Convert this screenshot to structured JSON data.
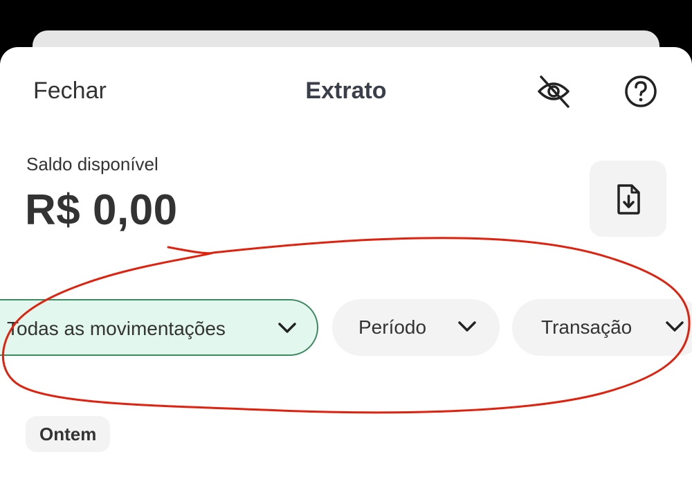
{
  "header": {
    "close_label": "Fechar",
    "title": "Extrato",
    "visibility_icon": "eye-off-icon",
    "help_icon": "help-circle-icon"
  },
  "balance": {
    "label": "Saldo disponível",
    "value": "R$ 0,00",
    "download_icon": "file-download-icon"
  },
  "filters": [
    {
      "label": "Todas as movimentações",
      "selected": true
    },
    {
      "label": "Período",
      "selected": false
    },
    {
      "label": "Transação",
      "selected": false
    }
  ],
  "list": {
    "date_group": "Ontem"
  },
  "colors": {
    "selected_chip_bg": "#e2f8ee",
    "selected_chip_border": "#3c8a60",
    "annotation": "#e0210e"
  }
}
